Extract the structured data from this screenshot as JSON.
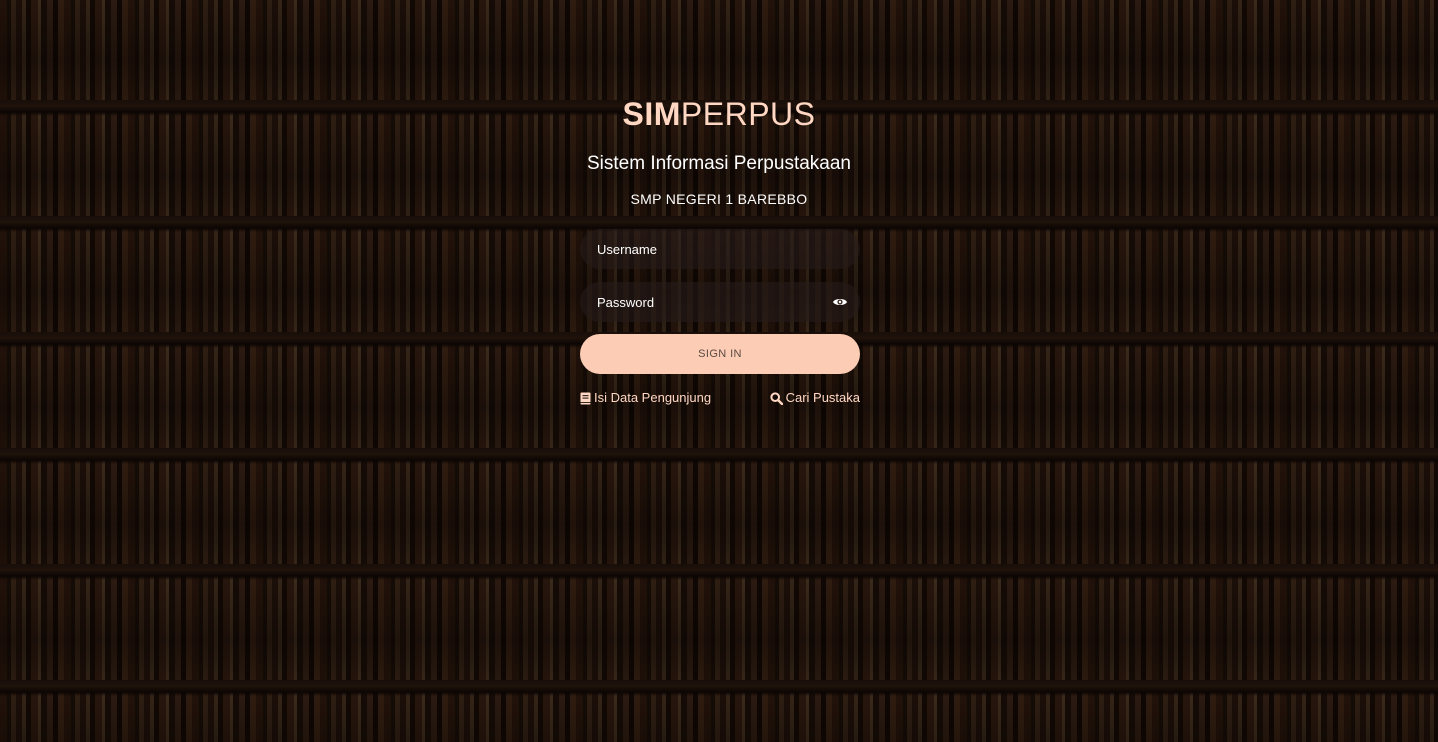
{
  "brand": {
    "part1": "SIM",
    "part2": "PERPUS"
  },
  "subtitle": "Sistem Informasi Perpustakaan",
  "school": "SMP NEGERI 1 BAREBBO",
  "form": {
    "username_placeholder": "Username",
    "password_placeholder": "Password",
    "signin_label": "SIGN IN"
  },
  "links": {
    "visitor_label": "Isi Data Pengunjung",
    "visitor_icon": "book-icon",
    "search_label": "Cari Pustaka",
    "search_icon": "search-icon"
  },
  "colors": {
    "accent": "#ffd7c2",
    "button_bg": "#fcccb4",
    "button_text": "#5a4a44"
  }
}
